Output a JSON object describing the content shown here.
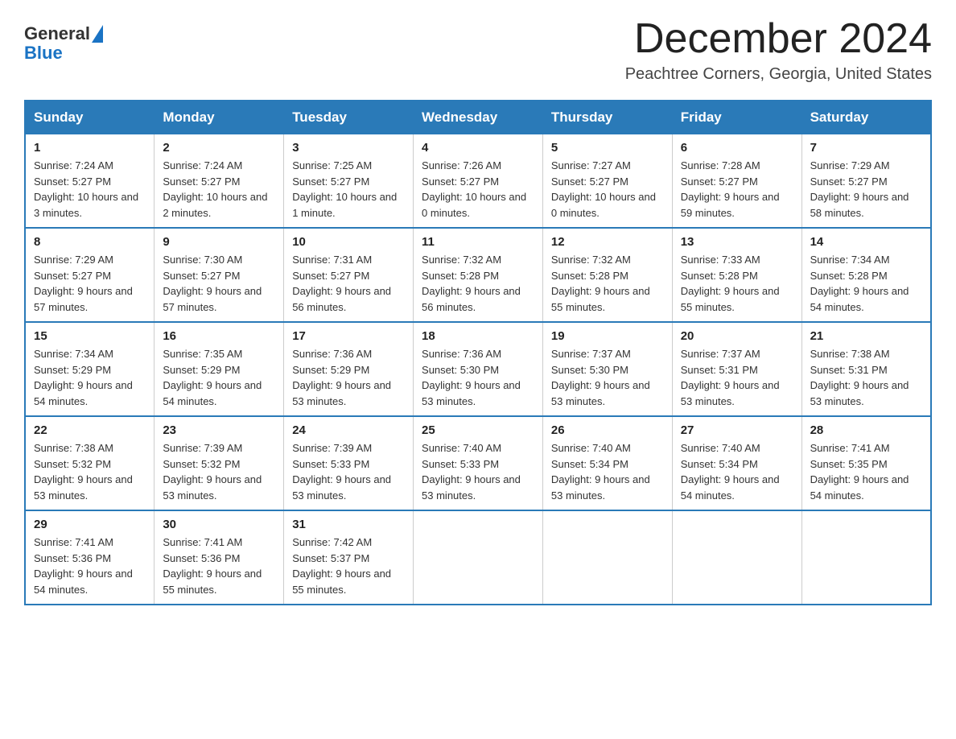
{
  "header": {
    "logo_general": "General",
    "logo_blue": "Blue",
    "month_title": "December 2024",
    "location": "Peachtree Corners, Georgia, United States"
  },
  "weekdays": [
    "Sunday",
    "Monday",
    "Tuesday",
    "Wednesday",
    "Thursday",
    "Friday",
    "Saturday"
  ],
  "weeks": [
    [
      {
        "day": "1",
        "sunrise": "7:24 AM",
        "sunset": "5:27 PM",
        "daylight": "10 hours and 3 minutes."
      },
      {
        "day": "2",
        "sunrise": "7:24 AM",
        "sunset": "5:27 PM",
        "daylight": "10 hours and 2 minutes."
      },
      {
        "day": "3",
        "sunrise": "7:25 AM",
        "sunset": "5:27 PM",
        "daylight": "10 hours and 1 minute."
      },
      {
        "day": "4",
        "sunrise": "7:26 AM",
        "sunset": "5:27 PM",
        "daylight": "10 hours and 0 minutes."
      },
      {
        "day": "5",
        "sunrise": "7:27 AM",
        "sunset": "5:27 PM",
        "daylight": "10 hours and 0 minutes."
      },
      {
        "day": "6",
        "sunrise": "7:28 AM",
        "sunset": "5:27 PM",
        "daylight": "9 hours and 59 minutes."
      },
      {
        "day": "7",
        "sunrise": "7:29 AM",
        "sunset": "5:27 PM",
        "daylight": "9 hours and 58 minutes."
      }
    ],
    [
      {
        "day": "8",
        "sunrise": "7:29 AM",
        "sunset": "5:27 PM",
        "daylight": "9 hours and 57 minutes."
      },
      {
        "day": "9",
        "sunrise": "7:30 AM",
        "sunset": "5:27 PM",
        "daylight": "9 hours and 57 minutes."
      },
      {
        "day": "10",
        "sunrise": "7:31 AM",
        "sunset": "5:27 PM",
        "daylight": "9 hours and 56 minutes."
      },
      {
        "day": "11",
        "sunrise": "7:32 AM",
        "sunset": "5:28 PM",
        "daylight": "9 hours and 56 minutes."
      },
      {
        "day": "12",
        "sunrise": "7:32 AM",
        "sunset": "5:28 PM",
        "daylight": "9 hours and 55 minutes."
      },
      {
        "day": "13",
        "sunrise": "7:33 AM",
        "sunset": "5:28 PM",
        "daylight": "9 hours and 55 minutes."
      },
      {
        "day": "14",
        "sunrise": "7:34 AM",
        "sunset": "5:28 PM",
        "daylight": "9 hours and 54 minutes."
      }
    ],
    [
      {
        "day": "15",
        "sunrise": "7:34 AM",
        "sunset": "5:29 PM",
        "daylight": "9 hours and 54 minutes."
      },
      {
        "day": "16",
        "sunrise": "7:35 AM",
        "sunset": "5:29 PM",
        "daylight": "9 hours and 54 minutes."
      },
      {
        "day": "17",
        "sunrise": "7:36 AM",
        "sunset": "5:29 PM",
        "daylight": "9 hours and 53 minutes."
      },
      {
        "day": "18",
        "sunrise": "7:36 AM",
        "sunset": "5:30 PM",
        "daylight": "9 hours and 53 minutes."
      },
      {
        "day": "19",
        "sunrise": "7:37 AM",
        "sunset": "5:30 PM",
        "daylight": "9 hours and 53 minutes."
      },
      {
        "day": "20",
        "sunrise": "7:37 AM",
        "sunset": "5:31 PM",
        "daylight": "9 hours and 53 minutes."
      },
      {
        "day": "21",
        "sunrise": "7:38 AM",
        "sunset": "5:31 PM",
        "daylight": "9 hours and 53 minutes."
      }
    ],
    [
      {
        "day": "22",
        "sunrise": "7:38 AM",
        "sunset": "5:32 PM",
        "daylight": "9 hours and 53 minutes."
      },
      {
        "day": "23",
        "sunrise": "7:39 AM",
        "sunset": "5:32 PM",
        "daylight": "9 hours and 53 minutes."
      },
      {
        "day": "24",
        "sunrise": "7:39 AM",
        "sunset": "5:33 PM",
        "daylight": "9 hours and 53 minutes."
      },
      {
        "day": "25",
        "sunrise": "7:40 AM",
        "sunset": "5:33 PM",
        "daylight": "9 hours and 53 minutes."
      },
      {
        "day": "26",
        "sunrise": "7:40 AM",
        "sunset": "5:34 PM",
        "daylight": "9 hours and 53 minutes."
      },
      {
        "day": "27",
        "sunrise": "7:40 AM",
        "sunset": "5:34 PM",
        "daylight": "9 hours and 54 minutes."
      },
      {
        "day": "28",
        "sunrise": "7:41 AM",
        "sunset": "5:35 PM",
        "daylight": "9 hours and 54 minutes."
      }
    ],
    [
      {
        "day": "29",
        "sunrise": "7:41 AM",
        "sunset": "5:36 PM",
        "daylight": "9 hours and 54 minutes."
      },
      {
        "day": "30",
        "sunrise": "7:41 AM",
        "sunset": "5:36 PM",
        "daylight": "9 hours and 55 minutes."
      },
      {
        "day": "31",
        "sunrise": "7:42 AM",
        "sunset": "5:37 PM",
        "daylight": "9 hours and 55 minutes."
      },
      null,
      null,
      null,
      null
    ]
  ]
}
